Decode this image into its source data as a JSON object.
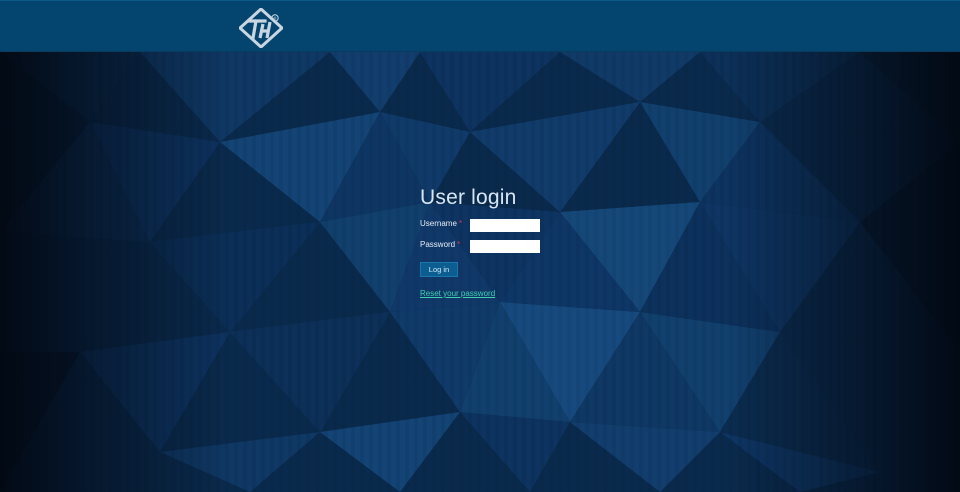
{
  "brand": {
    "logo_icon": "th-diamond-logo-icon"
  },
  "login": {
    "title": "User login",
    "username_label": "Username",
    "password_label": "Password",
    "required_marker": "*",
    "username_value": "",
    "password_value": "",
    "submit_label": "Log in",
    "reset_link": "Reset your password"
  },
  "colors": {
    "header": "#04456f",
    "background": "#071a30",
    "button": "#0d5e90",
    "link": "#3fd0b0",
    "required": "#e0344a"
  }
}
